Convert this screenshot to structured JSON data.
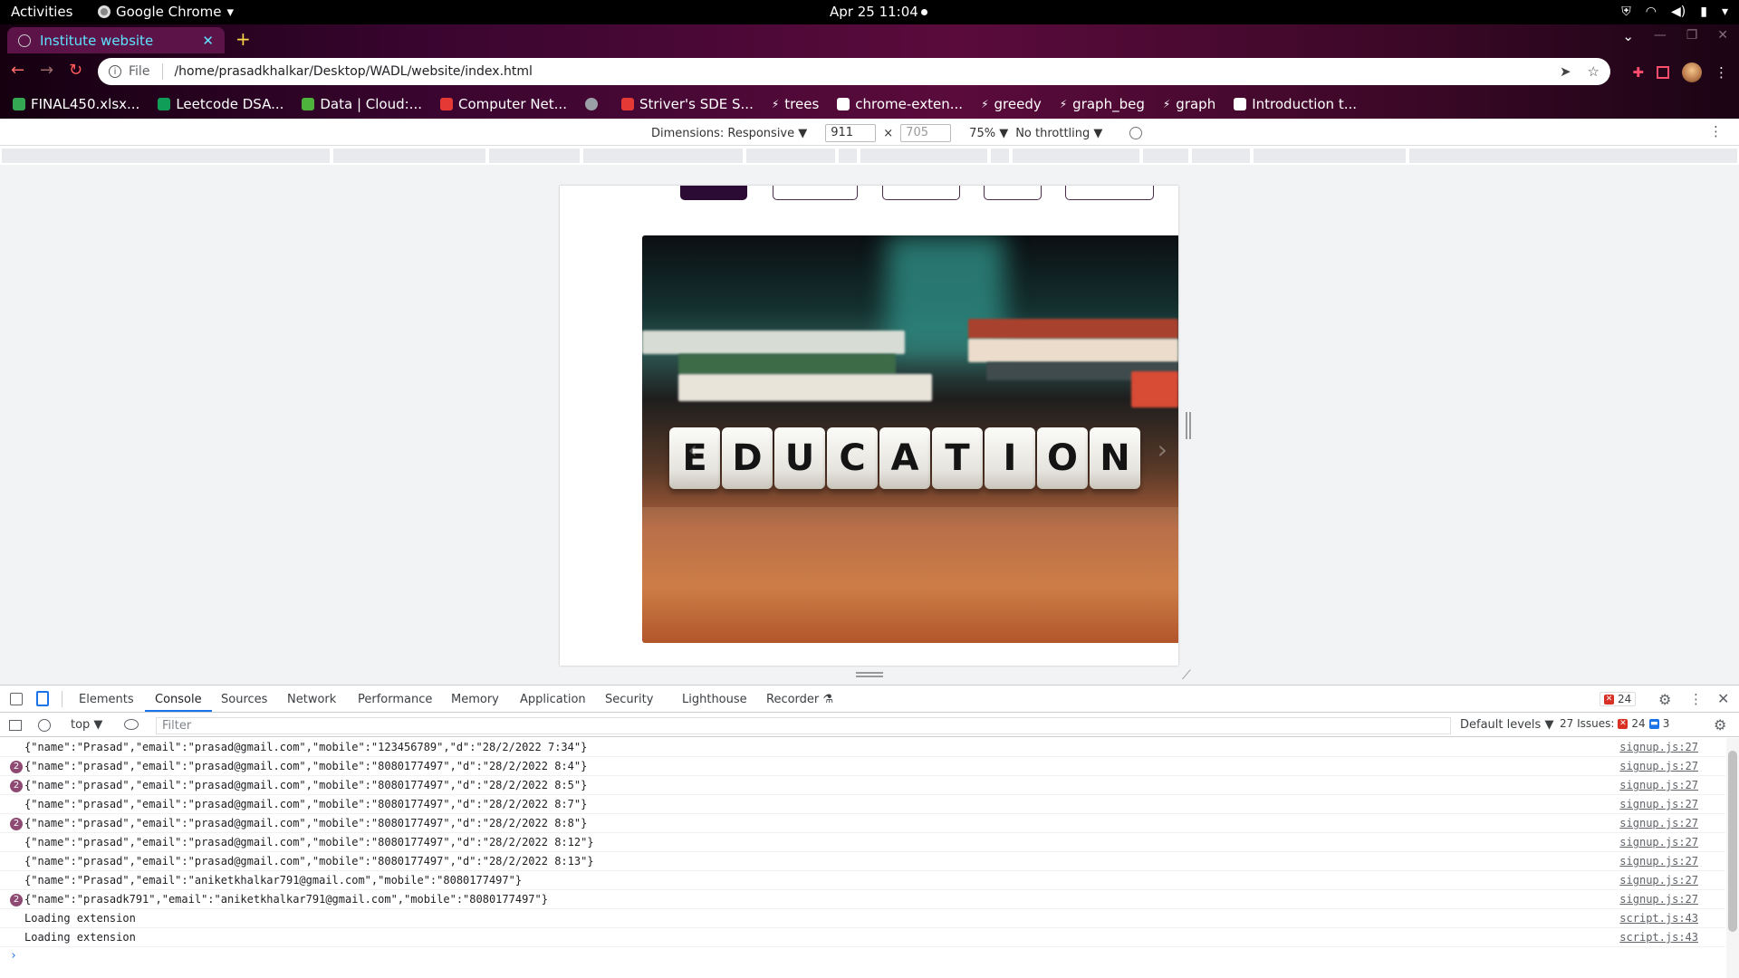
{
  "system": {
    "activities": "Activities",
    "app_name": "Google Chrome",
    "clock": "Apr 25  11:04"
  },
  "browser": {
    "tab_title": "Institute website",
    "omnibox_scheme": "File",
    "url": "/home/prasadkhalkar/Desktop/WADL/website/index.html",
    "bookmarks": [
      {
        "label": "FINAL450.xlsx...",
        "icon": "google-drive-icon",
        "color": "#34a853"
      },
      {
        "label": "Leetcode DSA...",
        "icon": "sheets-icon",
        "color": "#0f9d58"
      },
      {
        "label": "Data | Cloud:...",
        "icon": "leaf-icon",
        "color": "#4db33d"
      },
      {
        "label": "Computer Net...",
        "icon": "v-icon",
        "color": "#e53935"
      },
      {
        "label": "",
        "icon": "globe-icon",
        "color": "#9aa0a6"
      },
      {
        "label": "Striver's SDE S...",
        "icon": "tuf-icon",
        "color": "#e53935"
      },
      {
        "label": "trees",
        "icon": "bolt-icon",
        "color": "#ffffff"
      },
      {
        "label": "chrome-exten...",
        "icon": "lc-icon",
        "color": "#ffffff"
      },
      {
        "label": "greedy",
        "icon": "bolt-icon",
        "color": "#ffffff"
      },
      {
        "label": "graph_beg",
        "icon": "bolt-icon",
        "color": "#ffffff"
      },
      {
        "label": "graph",
        "icon": "bolt-icon",
        "color": "#ffffff"
      },
      {
        "label": "Introduction t...",
        "icon": "dev-icon",
        "color": "#ffffff"
      }
    ]
  },
  "device_toolbar": {
    "dimensions_label": "Dimensions: Responsive ▼",
    "width": "911",
    "times": "×",
    "height": "705",
    "zoom": "75% ▼",
    "throttling": "No throttling ▼"
  },
  "page": {
    "hero_word": [
      "E",
      "D",
      "U",
      "C",
      "A",
      "T",
      "I",
      "O",
      "N"
    ],
    "prev_arrow": "‹",
    "next_arrow": "›"
  },
  "devtools": {
    "tabs": [
      "Elements",
      "Console",
      "Sources",
      "Network",
      "Performance",
      "Memory",
      "Application",
      "Security",
      "Lighthouse",
      "Recorder ⚗"
    ],
    "error_count": "24",
    "context": "top ▼",
    "filter_placeholder": "Filter",
    "default_levels": "Default levels ▼",
    "issues_label": "27 Issues:",
    "issues_errors": "24",
    "issues_info": "3",
    "prompt": "›",
    "log": [
      {
        "count": "",
        "message": "{\"name\":\"Prasad\",\"email\":\"prasad@gmail.com\",\"mobile\":\"123456789\",\"d\":\"28/2/2022 7:34\"}",
        "source": "signup.js:27"
      },
      {
        "count": "2",
        "message": "{\"name\":\"prasad\",\"email\":\"prasad@gmail.com\",\"mobile\":\"8080177497\",\"d\":\"28/2/2022 8:4\"}",
        "source": "signup.js:27"
      },
      {
        "count": "2",
        "message": "{\"name\":\"prasad\",\"email\":\"prasad@gmail.com\",\"mobile\":\"8080177497\",\"d\":\"28/2/2022 8:5\"}",
        "source": "signup.js:27"
      },
      {
        "count": "",
        "message": "{\"name\":\"prasad\",\"email\":\"prasad@gmail.com\",\"mobile\":\"8080177497\",\"d\":\"28/2/2022 8:7\"}",
        "source": "signup.js:27"
      },
      {
        "count": "2",
        "message": "{\"name\":\"prasad\",\"email\":\"prasad@gmail.com\",\"mobile\":\"8080177497\",\"d\":\"28/2/2022 8:8\"}",
        "source": "signup.js:27"
      },
      {
        "count": "",
        "message": "{\"name\":\"prasad\",\"email\":\"prasad@gmail.com\",\"mobile\":\"8080177497\",\"d\":\"28/2/2022 8:12\"}",
        "source": "signup.js:27"
      },
      {
        "count": "",
        "message": "{\"name\":\"prasad\",\"email\":\"prasad@gmail.com\",\"mobile\":\"8080177497\",\"d\":\"28/2/2022 8:13\"}",
        "source": "signup.js:27"
      },
      {
        "count": "",
        "message": "{\"name\":\"Prasad\",\"email\":\"aniketkhalkar791@gmail.com\",\"mobile\":\"8080177497\"}",
        "source": "signup.js:27"
      },
      {
        "count": "2",
        "message": "{\"name\":\"prasadk791\",\"email\":\"aniketkhalkar791@gmail.com\",\"mobile\":\"8080177497\"}",
        "source": "signup.js:27"
      },
      {
        "count": "",
        "message": "Loading extension",
        "source": "script.js:43"
      },
      {
        "count": "",
        "message": "Loading extension",
        "source": "script.js:43"
      }
    ]
  }
}
